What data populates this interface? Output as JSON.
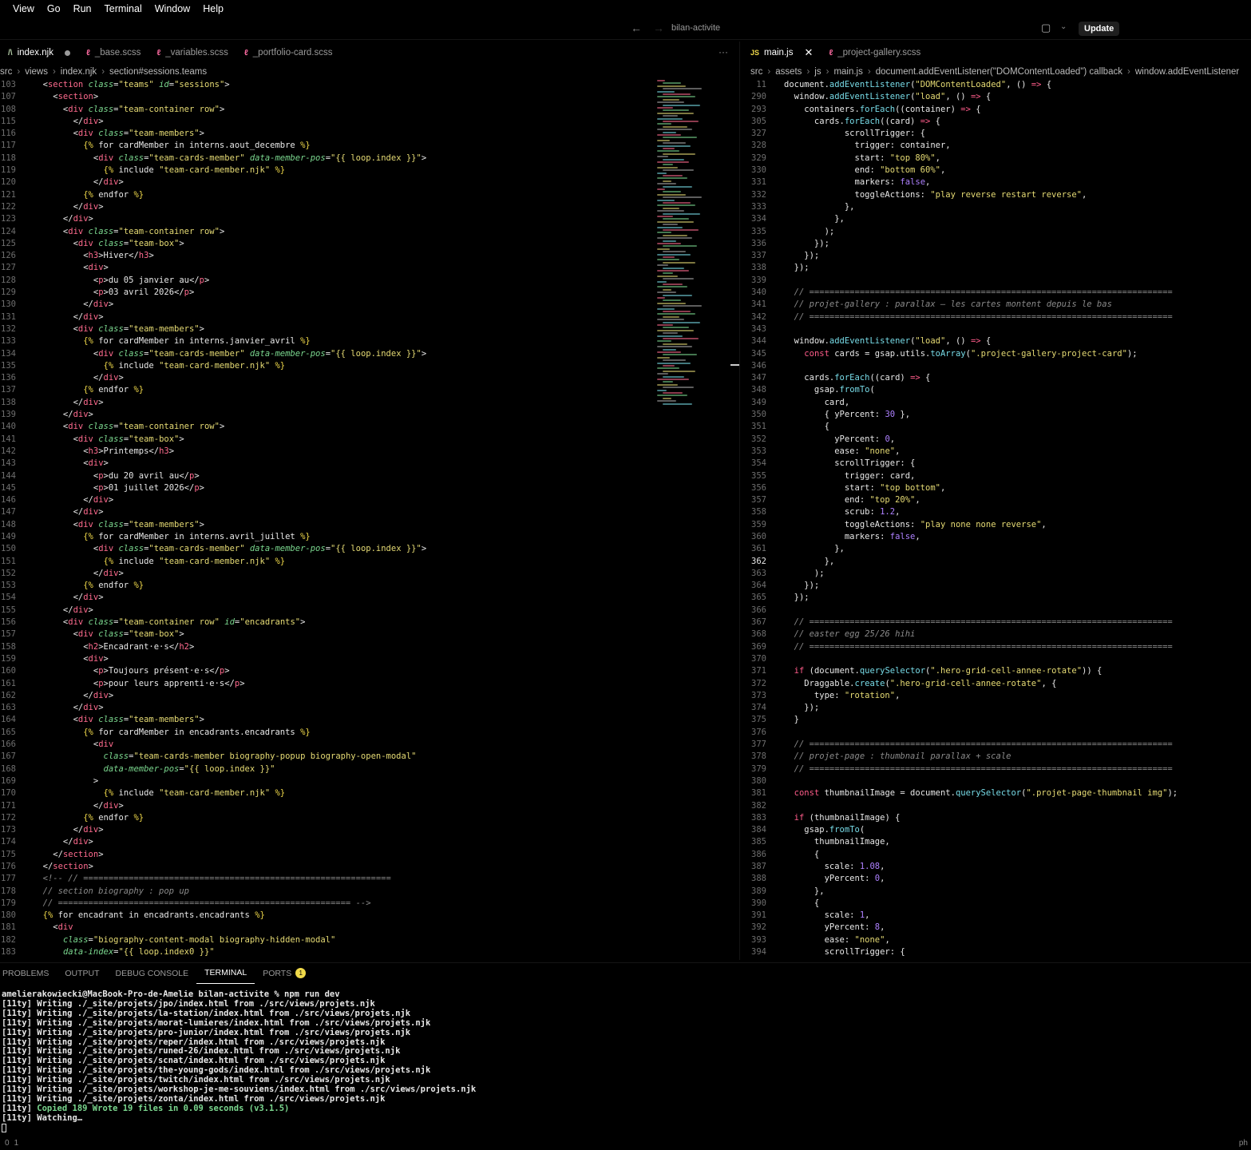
{
  "menubar": {
    "items": [
      "View",
      "Go",
      "Run",
      "Terminal",
      "Window",
      "Help"
    ]
  },
  "titlebar": {
    "title": "bilan-activite",
    "back": "←",
    "forward": "→",
    "update_label": "Update"
  },
  "left_tabs": [
    {
      "label": "index.njk",
      "icon": "njk-file-icon",
      "glyph": "/\\",
      "modified": true,
      "active": true
    },
    {
      "label": "_base.scss",
      "icon": "scss-file-icon",
      "glyph": "ℓ"
    },
    {
      "label": "_variables.scss",
      "icon": "scss-file-icon",
      "glyph": "ℓ"
    },
    {
      "label": "_portfolio-card.scss",
      "icon": "scss-file-icon",
      "glyph": "ℓ"
    }
  ],
  "left_more": "···",
  "right_tabs": [
    {
      "label": "main.js",
      "icon": "js-file-icon",
      "glyph": "JS",
      "active": true,
      "close": "✕"
    },
    {
      "label": "_project-gallery.scss",
      "icon": "scss-file-icon",
      "glyph": "ℓ"
    }
  ],
  "left_breadcrumb": [
    "src",
    "views",
    "index.njk",
    "section#sessions.teams"
  ],
  "right_breadcrumb": [
    "src",
    "assets",
    "js",
    "main.js",
    "document.addEventListener(\"DOMContentLoaded\") callback",
    "window.addEventListener"
  ],
  "left_editor": {
    "lines": [
      [
        "103",
        "  <section class=\"teams\" id=\"sessions\">"
      ],
      [
        "107",
        "    <section>"
      ],
      [
        "108",
        "      <div class=\"team-container row\">"
      ],
      [
        "115",
        "        </div>"
      ],
      [
        "116",
        "        <div class=\"team-members\">"
      ],
      [
        "117",
        "          {% for cardMember in interns.aout_decembre %}"
      ],
      [
        "118",
        "            <div class=\"team-cards-member\" data-member-pos=\"{{ loop.index }}\">"
      ],
      [
        "119",
        "              {% include \"team-card-member.njk\" %}"
      ],
      [
        "120",
        "            </div>"
      ],
      [
        "121",
        "          {% endfor %}"
      ],
      [
        "122",
        "        </div>"
      ],
      [
        "123",
        "      </div>"
      ],
      [
        "124",
        "      <div class=\"team-container row\">"
      ],
      [
        "125",
        "        <div class=\"team-box\">"
      ],
      [
        "126",
        "          <h3>Hiver</h3>"
      ],
      [
        "127",
        "          <div>"
      ],
      [
        "128",
        "            <p>du 05 janvier au</p>"
      ],
      [
        "129",
        "            <p>03 avril 2026</p>"
      ],
      [
        "130",
        "          </div>"
      ],
      [
        "131",
        "        </div>"
      ],
      [
        "132",
        "        <div class=\"team-members\">"
      ],
      [
        "133",
        "          {% for cardMember in interns.janvier_avril %}"
      ],
      [
        "134",
        "            <div class=\"team-cards-member\" data-member-pos=\"{{ loop.index }}\">"
      ],
      [
        "135",
        "              {% include \"team-card-member.njk\" %}"
      ],
      [
        "136",
        "            </div>"
      ],
      [
        "137",
        "          {% endfor %}"
      ],
      [
        "138",
        "        </div>"
      ],
      [
        "139",
        "      </div>"
      ],
      [
        "140",
        "      <div class=\"team-container row\">"
      ],
      [
        "141",
        "        <div class=\"team-box\">"
      ],
      [
        "142",
        "          <h3>Printemps</h3>"
      ],
      [
        "143",
        "          <div>"
      ],
      [
        "144",
        "            <p>du 20 avril au</p>"
      ],
      [
        "145",
        "            <p>01 juillet 2026</p>"
      ],
      [
        "146",
        "          </div>"
      ],
      [
        "147",
        "        </div>"
      ],
      [
        "148",
        "        <div class=\"team-members\">"
      ],
      [
        "149",
        "          {% for cardMember in interns.avril_juillet %}"
      ],
      [
        "150",
        "            <div class=\"team-cards-member\" data-member-pos=\"{{ loop.index }}\">"
      ],
      [
        "151",
        "              {% include \"team-card-member.njk\" %}"
      ],
      [
        "152",
        "            </div>"
      ],
      [
        "153",
        "          {% endfor %}"
      ],
      [
        "154",
        "        </div>"
      ],
      [
        "155",
        "      </div>"
      ],
      [
        "156",
        "      <div class=\"team-container row\" id=\"encadrants\">"
      ],
      [
        "157",
        "        <div class=\"team-box\">"
      ],
      [
        "158",
        "          <h2>Encadrant·e·s</h2>"
      ],
      [
        "159",
        "          <div>"
      ],
      [
        "160",
        "            <p>Toujours présent·e·s</p>"
      ],
      [
        "161",
        "            <p>pour leurs apprenti·e·s</p>"
      ],
      [
        "162",
        "          </div>"
      ],
      [
        "163",
        "        </div>"
      ],
      [
        "164",
        "        <div class=\"team-members\">"
      ],
      [
        "165",
        "          {% for cardMember in encadrants.encadrants %}"
      ],
      [
        "166",
        "            <div"
      ],
      [
        "167",
        "              class=\"team-cards-member biography-popup biography-open-modal\""
      ],
      [
        "168",
        "              data-member-pos=\"{{ loop.index }}\""
      ],
      [
        "169",
        "            >"
      ],
      [
        "170",
        "              {% include \"team-card-member.njk\" %}"
      ],
      [
        "171",
        "            </div>"
      ],
      [
        "172",
        "          {% endfor %}"
      ],
      [
        "173",
        "        </div>"
      ],
      [
        "174",
        "      </div>"
      ],
      [
        "175",
        "    </section>"
      ],
      [
        "176",
        "  </section>"
      ],
      [
        "177",
        "  <!-- // ============================================================="
      ],
      [
        "178",
        "  // section biography : pop up"
      ],
      [
        "179",
        "  // ========================================================== -->"
      ],
      [
        "180",
        "  {% for encadrant in encadrants.encadrants %}"
      ],
      [
        "181",
        "    <div"
      ],
      [
        "182",
        "      class=\"biography-content-modal biography-hidden-modal\""
      ],
      [
        "183",
        "      data-index=\"{{ loop.index0 }}\""
      ]
    ]
  },
  "right_editor": {
    "lines": [
      [
        "11",
        "document.addEventListener(\"DOMContentLoaded\", () => {"
      ],
      [
        "290",
        "  window.addEventListener(\"load\", () => {"
      ],
      [
        "293",
        "    containers.forEach((container) => {"
      ],
      [
        "305",
        "      cards.forEach((card) => {"
      ],
      [
        "327",
        "            scrollTrigger: {"
      ],
      [
        "328",
        "              trigger: container,"
      ],
      [
        "329",
        "              start: \"top 80%\","
      ],
      [
        "330",
        "              end: \"bottom 60%\","
      ],
      [
        "331",
        "              markers: false,"
      ],
      [
        "332",
        "              toggleActions: \"play reverse restart reverse\","
      ],
      [
        "333",
        "            },"
      ],
      [
        "334",
        "          },"
      ],
      [
        "335",
        "        );"
      ],
      [
        "336",
        "      });"
      ],
      [
        "337",
        "    });"
      ],
      [
        "338",
        "  });"
      ],
      [
        "339",
        ""
      ],
      [
        "340",
        "  // ========================================================================"
      ],
      [
        "341",
        "  // projet-gallery : parallax — les cartes montent depuis le bas"
      ],
      [
        "342",
        "  // ========================================================================"
      ],
      [
        "343",
        ""
      ],
      [
        "344",
        "  window.addEventListener(\"load\", () => {"
      ],
      [
        "345",
        "    const cards = gsap.utils.toArray(\".project-gallery-project-card\");"
      ],
      [
        "346",
        ""
      ],
      [
        "347",
        "    cards.forEach((card) => {"
      ],
      [
        "348",
        "      gsap.fromTo("
      ],
      [
        "349",
        "        card,"
      ],
      [
        "350",
        "        { yPercent: 30 },"
      ],
      [
        "351",
        "        {"
      ],
      [
        "352",
        "          yPercent: 0,"
      ],
      [
        "353",
        "          ease: \"none\","
      ],
      [
        "354",
        "          scrollTrigger: {"
      ],
      [
        "355",
        "            trigger: card,"
      ],
      [
        "356",
        "            start: \"top bottom\","
      ],
      [
        "357",
        "            end: \"top 20%\","
      ],
      [
        "358",
        "            scrub: 1.2,"
      ],
      [
        "359",
        "            toggleActions: \"play none none reverse\","
      ],
      [
        "360",
        "            markers: false,"
      ],
      [
        "361",
        "          },"
      ],
      [
        "362",
        "        },"
      ],
      [
        "363",
        "      );"
      ],
      [
        "364",
        "    });"
      ],
      [
        "365",
        "  });"
      ],
      [
        "366",
        ""
      ],
      [
        "367",
        "  // ========================================================================"
      ],
      [
        "368",
        "  // easter egg 25/26 hihi"
      ],
      [
        "369",
        "  // ========================================================================"
      ],
      [
        "370",
        ""
      ],
      [
        "371",
        "  if (document.querySelector(\".hero-grid-cell-annee-rotate\")) {"
      ],
      [
        "372",
        "    Draggable.create(\".hero-grid-cell-annee-rotate\", {"
      ],
      [
        "373",
        "      type: \"rotation\","
      ],
      [
        "374",
        "    });"
      ],
      [
        "375",
        "  }"
      ],
      [
        "376",
        ""
      ],
      [
        "377",
        "  // ========================================================================"
      ],
      [
        "378",
        "  // projet-page : thumbnail parallax + scale"
      ],
      [
        "379",
        "  // ========================================================================"
      ],
      [
        "380",
        ""
      ],
      [
        "381",
        "  const thumbnailImage = document.querySelector(\".projet-page-thumbnail img\");"
      ],
      [
        "382",
        ""
      ],
      [
        "383",
        "  if (thumbnailImage) {"
      ],
      [
        "384",
        "    gsap.fromTo("
      ],
      [
        "385",
        "      thumbnailImage,"
      ],
      [
        "386",
        "      {"
      ],
      [
        "387",
        "        scale: 1.08,"
      ],
      [
        "388",
        "        yPercent: 0,"
      ],
      [
        "389",
        "      },"
      ],
      [
        "390",
        "      {"
      ],
      [
        "391",
        "        scale: 1,"
      ],
      [
        "392",
        "        yPercent: 8,"
      ],
      [
        "393",
        "        ease: \"none\","
      ],
      [
        "394",
        "        scrollTrigger: {"
      ]
    ],
    "current_line": "362"
  },
  "panel": {
    "tabs": [
      "PROBLEMS",
      "OUTPUT",
      "DEBUG CONSOLE",
      "TERMINAL",
      "PORTS"
    ],
    "active": "TERMINAL",
    "ports_badge": "1"
  },
  "terminal": {
    "lines": [
      "amelierakowiecki@MacBook-Pro-de-Amelie bilan-activite % npm run dev",
      "[11ty] Writing ./_site/projets/jpo/index.html from ./src/views/projets.njk",
      "[11ty] Writing ./_site/projets/la-station/index.html from ./src/views/projets.njk",
      "[11ty] Writing ./_site/projets/morat-lumieres/index.html from ./src/views/projets.njk",
      "[11ty] Writing ./_site/projets/pro-junior/index.html from ./src/views/projets.njk",
      "[11ty] Writing ./_site/projets/reper/index.html from ./src/views/projets.njk",
      "[11ty] Writing ./_site/projets/runed-26/index.html from ./src/views/projets.njk",
      "[11ty] Writing ./_site/projets/scnat/index.html from ./src/views/projets.njk",
      "[11ty] Writing ./_site/projets/the-young-gods/index.html from ./src/views/projets.njk",
      "[11ty] Writing ./_site/projets/twitch/index.html from ./src/views/projets.njk",
      "[11ty] Writing ./_site/projets/workshop-je-me-souviens/index.html from ./src/views/projets.njk",
      "[11ty] Writing ./_site/projets/zonta/index.html from ./src/views/projets.njk"
    ],
    "summary_prefix": "[11ty] ",
    "summary": "Copied 189 Wrote 19 files in 0.09 seconds (v3.1.5)",
    "watching": "[11ty] Watching…"
  },
  "statusbar": {
    "left": [
      "0",
      "1"
    ],
    "right": "ph"
  }
}
